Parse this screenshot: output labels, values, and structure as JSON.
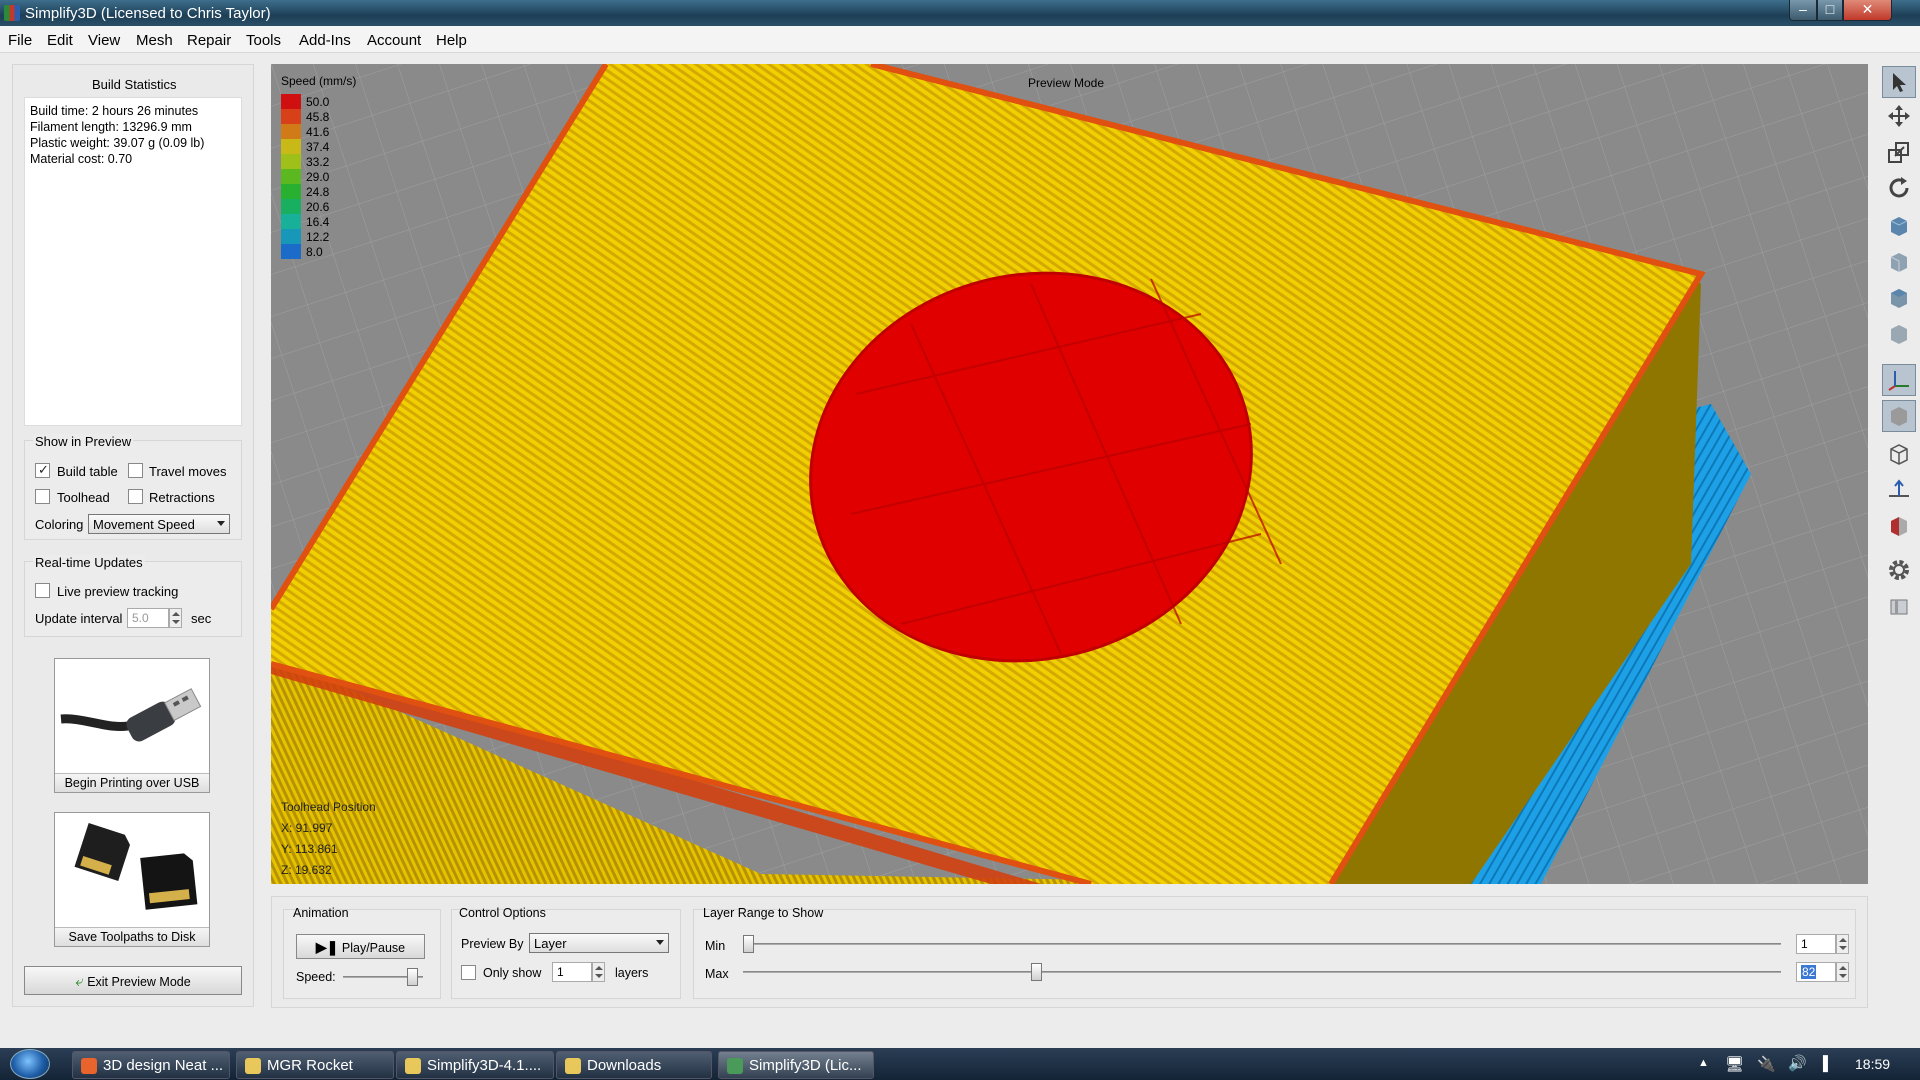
{
  "window": {
    "title": "Simplify3D (Licensed to Chris Taylor)",
    "controls": [
      "–",
      "□",
      "✕"
    ]
  },
  "menu": [
    "File",
    "Edit",
    "View",
    "Mesh",
    "Repair",
    "Tools",
    "Add-Ins",
    "Account",
    "Help"
  ],
  "build_stats": {
    "title": "Build Statistics",
    "lines": [
      "Build time: 2 hours 26 minutes",
      "Filament length: 13296.9 mm",
      "Plastic weight: 39.07 g (0.09 lb)",
      "Material cost: 0.70"
    ]
  },
  "show_in_preview": {
    "title": "Show in Preview",
    "build_table": {
      "label": "Build table",
      "checked": true
    },
    "travel_moves": {
      "label": "Travel moves",
      "checked": false
    },
    "toolhead": {
      "label": "Toolhead",
      "checked": false
    },
    "retractions": {
      "label": "Retractions",
      "checked": false
    },
    "coloring_label": "Coloring",
    "coloring_value": "Movement Speed"
  },
  "realtime": {
    "title": "Real-time Updates",
    "live_label": "Live preview tracking",
    "interval_label": "Update interval",
    "interval_value": "5.0",
    "interval_unit": "sec"
  },
  "usb_button": "Begin Printing over USB",
  "disk_button": "Save Toolpaths to Disk",
  "exit_button": "Exit Preview Mode",
  "viewport": {
    "mode": "Preview Mode",
    "legend_title": "Speed (mm/s)",
    "legend": [
      {
        "v": "50.0",
        "c": "#d01010"
      },
      {
        "v": "45.8",
        "c": "#d8401a"
      },
      {
        "v": "41.6",
        "c": "#d07a18"
      },
      {
        "v": "37.4",
        "c": "#c8b818"
      },
      {
        "v": "33.2",
        "c": "#9ec018"
      },
      {
        "v": "29.0",
        "c": "#5cb820"
      },
      {
        "v": "24.8",
        "c": "#28b030"
      },
      {
        "v": "20.6",
        "c": "#18b060"
      },
      {
        "v": "16.4",
        "c": "#18b098"
      },
      {
        "v": "12.2",
        "c": "#1898b8"
      },
      {
        "v": "8.0",
        "c": "#1a6cc8"
      }
    ],
    "toolhead_title": "Toolhead Position",
    "x": "X: 91.997",
    "y": "Y: 113.861",
    "z": "Z: 19.632"
  },
  "animation": {
    "title": "Animation",
    "play": "Play/Pause",
    "speed_label": "Speed:",
    "speed_level": 0.85
  },
  "control": {
    "title": "Control Options",
    "preview_by_label": "Preview By",
    "preview_by_value": "Layer",
    "only_show_label": "Only show",
    "only_show_value": "1",
    "layers_label": "layers"
  },
  "layer_range": {
    "title": "Layer Range to Show",
    "min_label": "Min",
    "max_label": "Max",
    "min_value": "1",
    "max_value": "82",
    "min_pos": 0.0,
    "max_pos": 0.28
  },
  "taskbar": {
    "tasks": [
      {
        "label": "3D design Neat ...",
        "color": "#e8642c"
      },
      {
        "label": "MGR Rocket",
        "color": "#e8c85a"
      },
      {
        "label": "Simplify3D-4.1....",
        "color": "#e8c85a"
      },
      {
        "label": "Downloads",
        "color": "#e8c85a"
      },
      {
        "label": "Simplify3D (Lic...",
        "color": "#4a9a5a"
      }
    ],
    "clock": "18:59"
  },
  "colors": {
    "fill_yellow": "#e6c200",
    "fill_red": "#e00000",
    "support_blue": "#1ea0e6",
    "grid_bg": "#8a8a8a"
  }
}
